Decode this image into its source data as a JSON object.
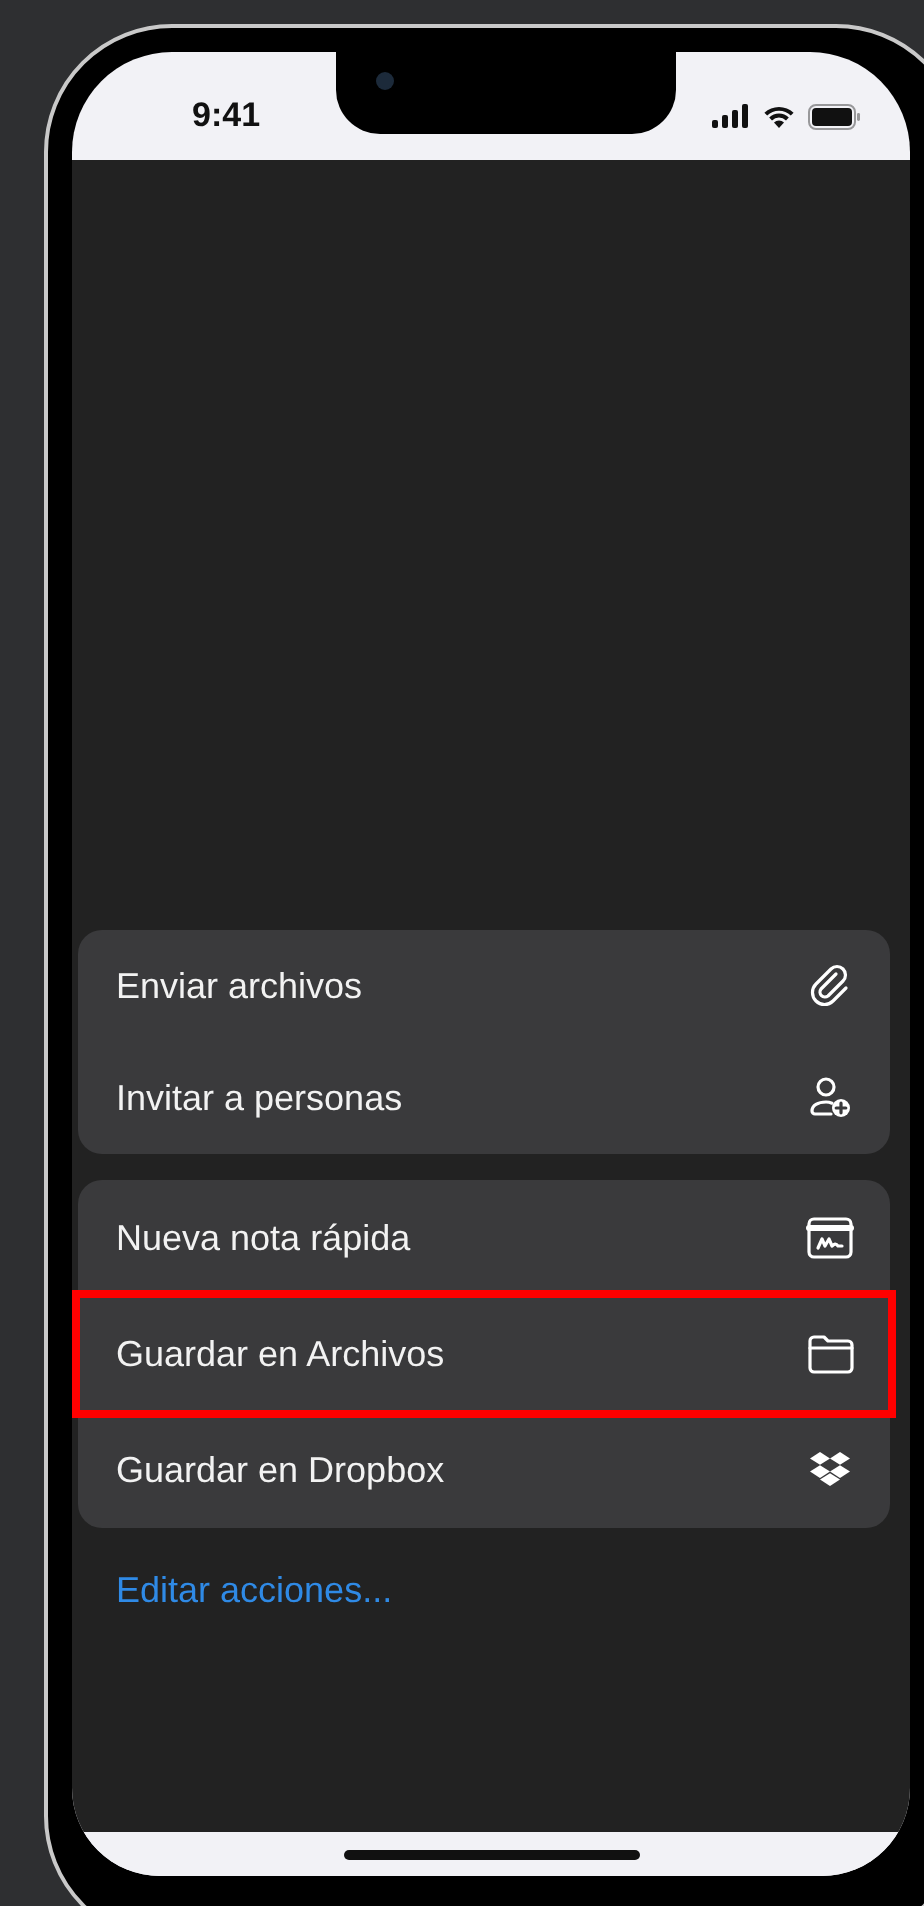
{
  "status_bar": {
    "time": "9:41"
  },
  "action_groups": [
    {
      "items": [
        {
          "label": "Enviar archivos",
          "highlighted": false
        },
        {
          "label": "Invitar a personas",
          "highlighted": false
        }
      ]
    },
    {
      "items": [
        {
          "label": "Nueva nota rápida",
          "highlighted": false
        },
        {
          "label": "Guardar en Archivos",
          "highlighted": true
        },
        {
          "label": "Guardar en Dropbox",
          "highlighted": false
        }
      ]
    }
  ],
  "edit_link": "Editar acciones..."
}
